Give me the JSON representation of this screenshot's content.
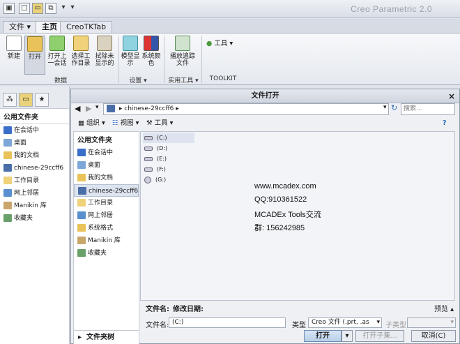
{
  "window": {
    "title": "Creo Parametric 2.0"
  },
  "tabs": [
    {
      "label": "文件"
    },
    {
      "label": "主页"
    },
    {
      "label": "CreoTKTab"
    }
  ],
  "ribbon": {
    "buttons": [
      {
        "label": "新建",
        "icon": "new-document-icon"
      },
      {
        "label": "打开",
        "icon": "open-folder-icon"
      },
      {
        "label": "打开上一会话",
        "icon": "open-last-session-icon"
      },
      {
        "label": "选择工作目录",
        "icon": "working-directory-icon"
      },
      {
        "label": "拭除未显示的",
        "icon": "erase-icon"
      },
      {
        "label": "模型显示",
        "icon": "model-display-icon"
      },
      {
        "label": "系统颜色",
        "icon": "system-color-icon"
      },
      {
        "label": "播放追踪文件",
        "icon": "play-trail-icon"
      }
    ],
    "groups": [
      "数据",
      "设置",
      "实用工具",
      "TOOLKIT"
    ],
    "tools_label": "工具"
  },
  "nav": {
    "heading": "公用文件夹",
    "items": [
      "在会话中",
      "桌面",
      "我的文档",
      "chinese-29ccff6",
      "工作目录",
      "网上邻居",
      "Manikin 库",
      "收藏夹"
    ]
  },
  "dialog": {
    "title": "文件打开",
    "close": "×",
    "address": "chinese-29ccff6",
    "search_placeholder": "搜索...",
    "toolbar": {
      "organize": "组织",
      "views": "视图",
      "tools": "工具"
    },
    "left_heading": "公用文件夹",
    "left_items": [
      "在会话中",
      "桌面",
      "我的文档",
      "chinese-29ccff6",
      "工作目录",
      "网上邻居",
      "系统格式",
      "Manikin 库",
      "收藏夹"
    ],
    "drives": [
      "(C:)",
      "(D:)",
      "(E:)",
      "(F:)",
      "(G:)"
    ],
    "watermark": [
      "www.mcadex.com",
      "QQ:910361522",
      "MCADEx Tools交流",
      "群: 156242985"
    ],
    "status": {
      "name_label": "文件名:",
      "date_label": "修改日期:",
      "preview": "预览"
    },
    "filename_label": "文件名:",
    "filename_value": "(C:)",
    "type_label": "类型",
    "type_value": "Creo 文件 (.prt, .as",
    "subtype_label": "子类型",
    "folder_tree": "文件夹树",
    "open_button": "打开",
    "open_sub_button": "打开子集...",
    "cancel_button": "取消(C)"
  }
}
